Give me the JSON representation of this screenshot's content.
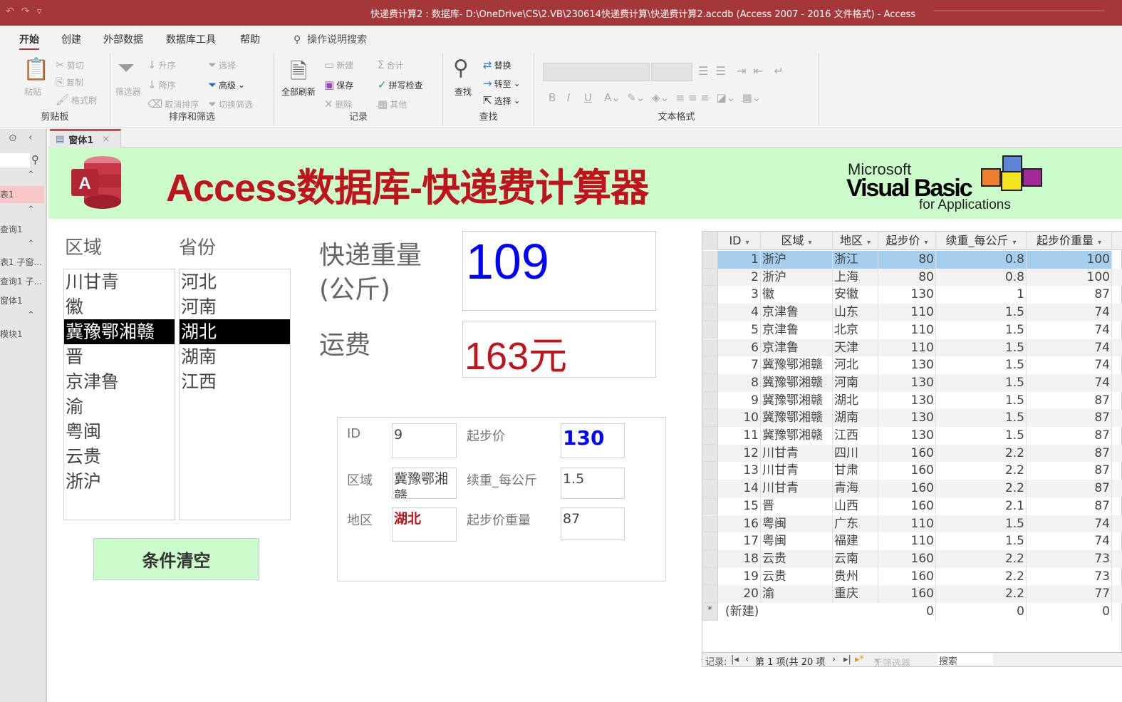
{
  "window": {
    "title": "快递费计算2 : 数据库- D:\\OneDrive\\CS\\2.VB\\230614快递费计算\\快递费计算2.accdb (Access 2007 - 2016 文件格式)  -  Access",
    "qat": {
      "undo_icon": "↶",
      "redo_icon": "↷",
      "customize_icon": "▿"
    }
  },
  "ribbon": {
    "tabs": [
      {
        "label": "开始",
        "active": true
      },
      {
        "label": "创建"
      },
      {
        "label": "外部数据"
      },
      {
        "label": "数据库工具"
      },
      {
        "label": "帮助"
      }
    ],
    "tell_me": "操作说明搜索",
    "groups": {
      "clipboard": {
        "label": "剪贴板",
        "paste": "粘贴",
        "cut": "剪切",
        "copy": "复制",
        "format_painter": "格式刷"
      },
      "sort_filter": {
        "label": "排序和筛选",
        "filter": "筛选器",
        "ascending": "升序",
        "descending": "降序",
        "remove_sort": "取消排序",
        "selection": "选择",
        "advanced": "高级",
        "toggle_filter": "切换筛选"
      },
      "records": {
        "label": "记录",
        "refresh_all": "全部刷新",
        "new": "新建",
        "save": "保存",
        "delete": "删除",
        "totals": "合计",
        "spelling": "拼写检查",
        "more": "其他"
      },
      "find": {
        "label": "查找",
        "find": "查找",
        "replace": "替换",
        "goto": "转至",
        "select": "选择"
      },
      "text_format": {
        "label": "文本格式",
        "bold": "B",
        "italic": "I",
        "underline": "U"
      }
    }
  },
  "nav_pane": {
    "items": [
      {
        "label": "表1",
        "selected": true
      },
      {
        "label": "查询1"
      },
      {
        "label": "表1 子窗..."
      },
      {
        "label": "查询1 子..."
      },
      {
        "label": "窗体1"
      },
      {
        "label": "模块1"
      }
    ]
  },
  "document_tab": {
    "label": "窗体1"
  },
  "form": {
    "header": {
      "title": "Access数据库-快递费计算器",
      "logo_letter": "A",
      "vba_logo": {
        "line1": "Microsoft",
        "line2": "Visual Basic",
        "line3": "for Applications"
      }
    },
    "region_label": "区域",
    "province_label": "省份",
    "regions": [
      "川甘青",
      "徽",
      "冀豫鄂湘赣",
      "晋",
      "京津鲁",
      "渝",
      "粤闽",
      "云贵",
      "浙沪"
    ],
    "region_selected": "冀豫鄂湘赣",
    "provinces": [
      "河北",
      "河南",
      "湖北",
      "湖南",
      "江西"
    ],
    "province_selected": "湖北",
    "weight_label_1": "快递重量",
    "weight_label_2": "(公斤)",
    "weight_value": "109",
    "fee_label": "运费",
    "fee_value": "163元",
    "clear_button": "条件清空",
    "detail": {
      "id_label": "ID",
      "id_value": "9",
      "region_label": "区域",
      "region_value": "冀豫鄂湘赣",
      "area_label": "地区",
      "area_value": "湖北",
      "base_price_label": "起步价",
      "base_price_value": "130",
      "extra_label": "续重_每公斤",
      "extra_value": "1.5",
      "base_weight_label": "起步价重量",
      "base_weight_value": "87"
    }
  },
  "datasheet": {
    "columns": [
      "ID",
      "区域",
      "地区",
      "起步价",
      "续重_每公斤",
      "起步价重量"
    ],
    "rows": [
      [
        1,
        "浙沪",
        "浙江",
        80,
        0.8,
        100
      ],
      [
        2,
        "浙沪",
        "上海",
        80,
        0.8,
        100
      ],
      [
        3,
        "徽",
        "安徽",
        130,
        1,
        87
      ],
      [
        4,
        "京津鲁",
        "山东",
        110,
        1.5,
        74
      ],
      [
        5,
        "京津鲁",
        "北京",
        110,
        1.5,
        74
      ],
      [
        6,
        "京津鲁",
        "天津",
        110,
        1.5,
        74
      ],
      [
        7,
        "冀豫鄂湘赣",
        "河北",
        130,
        1.5,
        74
      ],
      [
        8,
        "冀豫鄂湘赣",
        "河南",
        130,
        1.5,
        74
      ],
      [
        9,
        "冀豫鄂湘赣",
        "湖北",
        130,
        1.5,
        87
      ],
      [
        10,
        "冀豫鄂湘赣",
        "湖南",
        130,
        1.5,
        87
      ],
      [
        11,
        "冀豫鄂湘赣",
        "江西",
        130,
        1.5,
        87
      ],
      [
        12,
        "川甘青",
        "四川",
        160,
        2.2,
        87
      ],
      [
        13,
        "川甘青",
        "甘肃",
        160,
        2.2,
        87
      ],
      [
        14,
        "川甘青",
        "青海",
        160,
        2.2,
        87
      ],
      [
        15,
        "晋",
        "山西",
        160,
        2.1,
        87
      ],
      [
        16,
        "粤闽",
        "广东",
        110,
        1.5,
        74
      ],
      [
        17,
        "粤闽",
        "福建",
        110,
        1.5,
        74
      ],
      [
        18,
        "云贵",
        "云南",
        160,
        2.2,
        73
      ],
      [
        19,
        "云贵",
        "贵州",
        160,
        2.2,
        73
      ],
      [
        20,
        "渝",
        "重庆",
        160,
        2.2,
        77
      ]
    ],
    "selected_row": 1,
    "new_row": {
      "marker": "*",
      "label": "(新建)",
      "values": [
        0,
        0,
        0
      ]
    },
    "status": {
      "record_label": "记录:",
      "position": "第 1 项(共 20 项",
      "filter": "无筛选器",
      "search": "搜索"
    }
  },
  "colors": {
    "title_bar": "#a4373a",
    "header_bg": "#ccfccc",
    "title_red": "#c0141c",
    "weight_blue": "#0000ff",
    "fee_red": "#c0141c",
    "selected_row": "#a5cdee"
  }
}
